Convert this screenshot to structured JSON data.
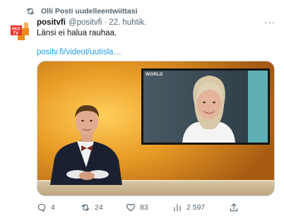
{
  "retweet": {
    "text": "Olli Posti uudelleentwiittasi"
  },
  "tweet": {
    "avatar_label": "RED TV",
    "display_name": "positvfi",
    "handle": "@positvfi",
    "separator": "·",
    "date": "22. huhtik.",
    "text": "Länsi ei halua rauhaa.",
    "link": "positv.fi/videot/uutisla…",
    "more_label": "···"
  },
  "media": {
    "inset_logo": "WORLD"
  },
  "actions": {
    "replies": "4",
    "retweets": "24",
    "likes": "83",
    "views": "2 597"
  },
  "colors": {
    "link": "#1d9bf0",
    "muted": "#536471",
    "logo_red": "#e8332a",
    "logo_orange": "#f08a1d"
  }
}
